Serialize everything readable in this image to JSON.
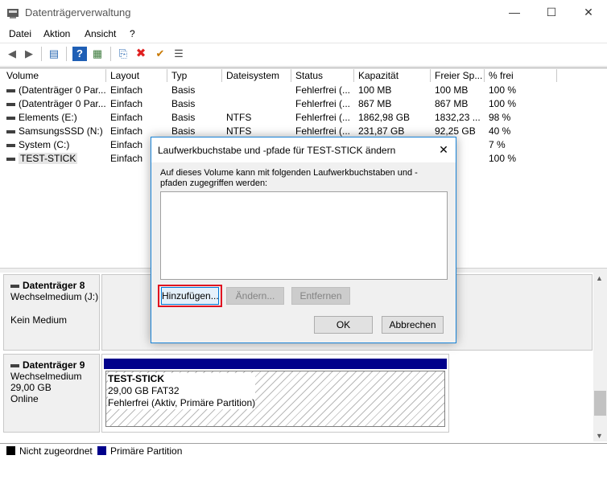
{
  "window": {
    "title": "Datenträgerverwaltung",
    "minimize_glyph": "—",
    "maximize_glyph": "☐",
    "close_glyph": "✕"
  },
  "menu": [
    "Datei",
    "Aktion",
    "Ansicht",
    "?"
  ],
  "toolbar": {
    "icons": [
      "back-arrow-icon",
      "forward-arrow-icon",
      "disk-list-icon",
      "help-icon",
      "properties-icon",
      "connect-icon",
      "delete-x-icon",
      "check-icon",
      "settings-icon"
    ],
    "back_glyph": "◀",
    "forward_glyph": "▶",
    "list_glyph": "▤",
    "help_glyph": "?",
    "props_glyph": "▦",
    "connect_glyph": "⎘",
    "delete_glyph": "✖",
    "check_glyph": "✔",
    "settings_glyph": "☰"
  },
  "table": {
    "headers": [
      "Volume",
      "Layout",
      "Typ",
      "Dateisystem",
      "Status",
      "Kapazität",
      "Freier Sp...",
      "% frei"
    ],
    "rows": [
      [
        "(Datenträger 0 Par...",
        "Einfach",
        "Basis",
        "",
        "Fehlerfrei (...",
        "100 MB",
        "100 MB",
        "100 %"
      ],
      [
        "(Datenträger 0 Par...",
        "Einfach",
        "Basis",
        "",
        "Fehlerfrei (...",
        "867 MB",
        "867 MB",
        "100 %"
      ],
      [
        "Elements (E:)",
        "Einfach",
        "Basis",
        "NTFS",
        "Fehlerfrei (...",
        "1862,98 GB",
        "1832,23 ...",
        "98 %"
      ],
      [
        "SamsungsSSD (N:)",
        "Einfach",
        "Basis",
        "NTFS",
        "Fehlerfrei (...",
        "231,87 GB",
        "92,25 GB",
        "40 %"
      ],
      [
        "System (C:)",
        "Einfach",
        "",
        "",
        "",
        "",
        "GB",
        "7 %"
      ],
      [
        "TEST-STICK",
        "Einfach",
        "",
        "",
        "",
        "",
        "GB",
        "100 %"
      ]
    ]
  },
  "disks": [
    {
      "name": "Datenträger 8",
      "type": "Wechselmedium (J:)",
      "line3": "",
      "status": "Kein Medium"
    },
    {
      "name": "Datenträger 9",
      "type": "Wechselmedium",
      "line3": "29,00 GB",
      "status": "Online",
      "partition": {
        "name": "TEST-STICK",
        "size": "29,00 GB FAT32",
        "status": "Fehlerfrei (Aktiv, Primäre Partition)"
      }
    }
  ],
  "legend": [
    {
      "label": "Nicht zugeordnet",
      "color": "#000000"
    },
    {
      "label": "Primäre Partition",
      "color": "#00008b"
    }
  ],
  "dialog": {
    "title": "Laufwerkbuchstabe und -pfade für TEST-STICK ändern",
    "close_glyph": "✕",
    "description": "Auf dieses Volume kann mit folgenden Laufwerkbuchstaben und -pfaden zugegriffen werden:",
    "buttons": {
      "add": "Hinzufügen...",
      "change": "Ändern...",
      "remove": "Entfernen",
      "ok": "OK",
      "cancel": "Abbrechen"
    }
  }
}
